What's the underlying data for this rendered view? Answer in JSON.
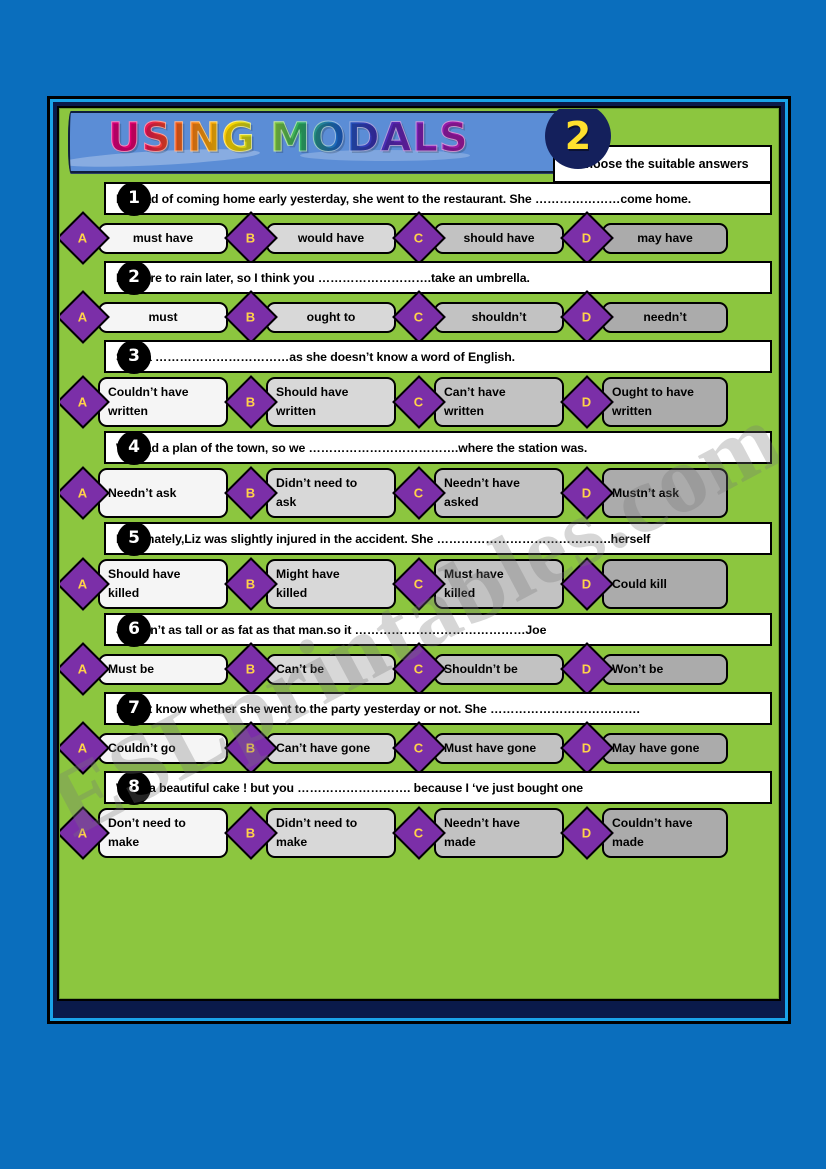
{
  "page": {
    "background_color": "#0a6ebd",
    "sheet_color": "#8cc63f",
    "watermark": "ESLprintables.com"
  },
  "header": {
    "title": "USING MODALS",
    "badge_number": "2",
    "instruction": "Choose the suitable answers",
    "title_gradient_colors": [
      "#d4007f",
      "#f04b20",
      "#fbd700",
      "#2fae5e",
      "#1b62c4",
      "#a5179f"
    ],
    "badge_bg": "#14205c",
    "badge_text_color": "#ffe02e"
  },
  "option_letters": [
    "A",
    "B",
    "C",
    "D"
  ],
  "questions": [
    {
      "number": "1",
      "text": "Instead of coming home early yesterday, she went to the restaurant. She …………………come home.",
      "layout": "center",
      "options": [
        "must have",
        "would have",
        "should have",
        "may have"
      ]
    },
    {
      "number": "2",
      "text": "It’s sure to rain later, so I think you ……………………….take an umbrella.",
      "layout": "center",
      "options": [
        "must",
        "ought to",
        "shouldn’t",
        "needn’t"
      ]
    },
    {
      "number": "3",
      "text": "Salma ……………………………as she doesn’t know a word of English.",
      "layout": "left",
      "options": [
        "Couldn’t have\nwritten",
        "Should have\nwritten",
        "Can’t have\nwritten",
        "Ought to have\nwritten"
      ]
    },
    {
      "number": "4",
      "text": "We had a plan of the town, so we ……………………………….where the station was.",
      "layout": "left",
      "options": [
        "Needn’t ask",
        "Didn’t need to\nask",
        "Needn’t have\nasked",
        "Mustn’t ask"
      ]
    },
    {
      "number": "5",
      "text": "Fortunately,Liz was slightly injured in the accident. She …………………………………….herself",
      "layout": "left",
      "options": [
        "Should have\nkilled",
        "Might have\nkilled",
        "Must have\nkilled",
        "Could kill"
      ]
    },
    {
      "number": "6",
      "text": "Joe isn’t as tall or as fat as that man.so it ……………………………………Joe",
      "layout": "left",
      "options": [
        "Must be",
        "Can’t be",
        "Shouldn’t be",
        "Won’t be"
      ]
    },
    {
      "number": "7",
      "text": "I don’t know whether she went to the party yesterday or not. She ……………………………….",
      "layout": "left",
      "options": [
        "Couldn’t go",
        "Can’t have gone",
        "Must have gone",
        "May have gone"
      ]
    },
    {
      "number": "8",
      "text": "What a beautiful cake ! but you ………………………. because I ‘ve just bought one",
      "layout": "left",
      "options": [
        "Don’t need to\nmake",
        "Didn’t need to\nmake",
        "Needn’t have\nmade",
        "Couldn’t have\nmade"
      ]
    }
  ]
}
